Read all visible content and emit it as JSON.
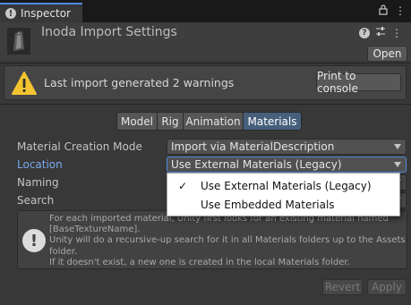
{
  "window": {
    "tab_title": "Inspector",
    "tab_icon": "info-icon"
  },
  "header": {
    "title": "Inoda Import Settings",
    "open_label": "Open"
  },
  "warning": {
    "text": "Last import generated 2 warnings",
    "print_label": "Print to console"
  },
  "tabs": [
    {
      "label": "Model",
      "active": false
    },
    {
      "label": "Rig",
      "active": false
    },
    {
      "label": "Animation",
      "active": false
    },
    {
      "label": "Materials",
      "active": true
    }
  ],
  "fields": {
    "material_creation_mode": {
      "label": "Material Creation Mode",
      "value": "Import via MaterialDescription"
    },
    "location": {
      "label": "Location",
      "value": "Use External Materials (Legacy)"
    },
    "naming": {
      "label": "Naming"
    },
    "search": {
      "label": "Search"
    }
  },
  "info": {
    "lines": [
      "For each imported material, Unity first looks for an existing material named",
      "[BaseTextureName].",
      "Unity will do a recursive-up search for it in all Materials folders up to the Assets",
      "folder.",
      "If it doesn't exist, a new one is created in the local Materials folder."
    ]
  },
  "footer": {
    "revert_label": "Revert",
    "apply_label": "Apply"
  },
  "popup": {
    "items": [
      {
        "label": "Use External Materials (Legacy)",
        "checked": true,
        "check_glyph": "✓"
      },
      {
        "label": "Use Embedded Materials",
        "checked": false,
        "check_glyph": ""
      }
    ]
  },
  "colors": {
    "accent": "#4d8ae0",
    "active_tab": "#46607c",
    "warning": "#f4c430"
  }
}
